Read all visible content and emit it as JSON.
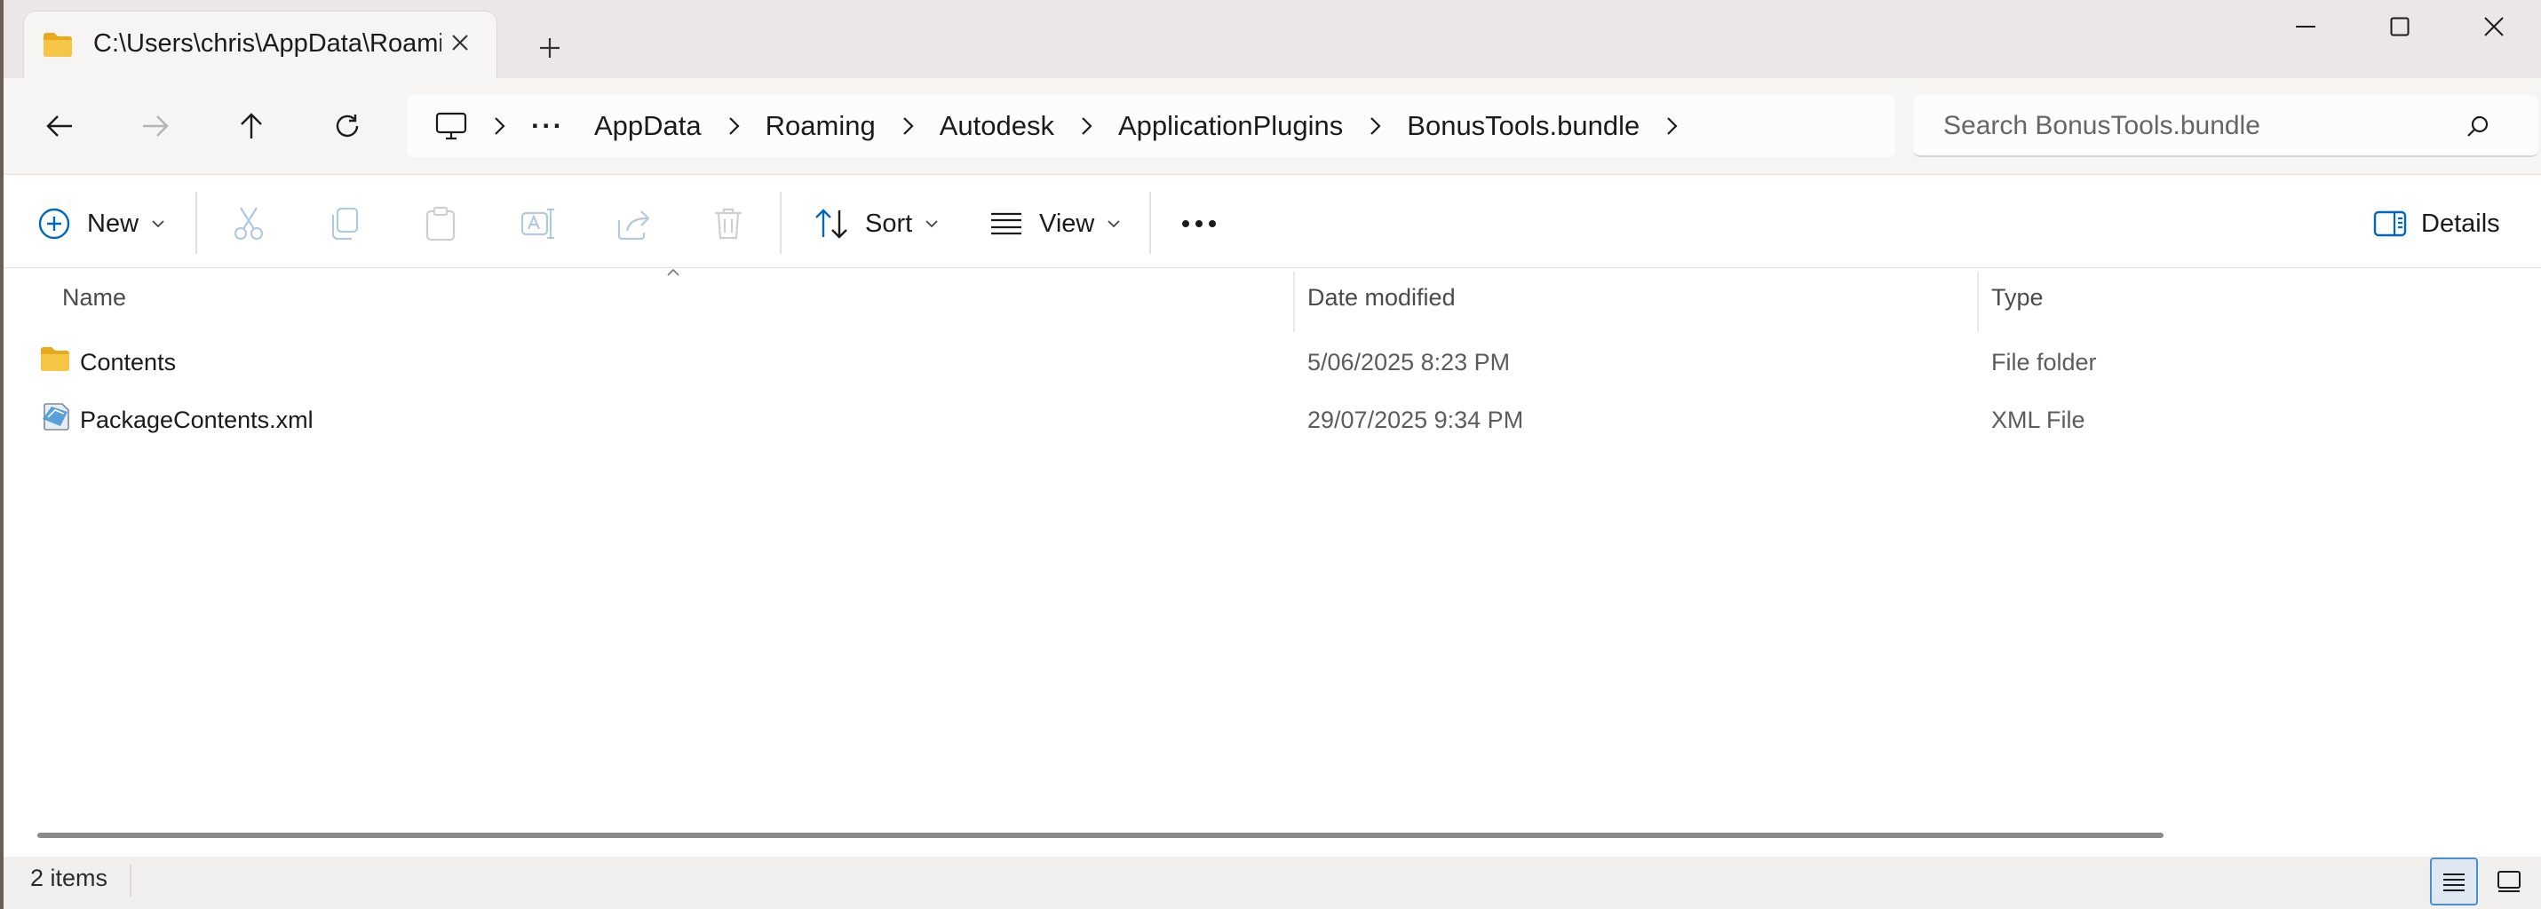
{
  "window": {
    "tab_title": "C:\\Users\\chris\\AppData\\Roaming\\Autodesk\\ApplicationPlugins\\BonusTools.bundle",
    "new_tab_label": "+"
  },
  "nav": {
    "breadcrumb": [
      "AppData",
      "Roaming",
      "Autodesk",
      "ApplicationPlugins",
      "BonusTools.bundle"
    ],
    "overflow_label": "···",
    "search_placeholder": "Search BonusTools.bundle"
  },
  "commands": {
    "new_label": "New",
    "sort_label": "Sort",
    "view_label": "View",
    "details_label": "Details"
  },
  "columns": {
    "name": "Name",
    "date": "Date modified",
    "type": "Type"
  },
  "files": [
    {
      "name": "Contents",
      "date": "5/06/2025 8:23 PM",
      "type": "File folder",
      "icon": "folder-icon"
    },
    {
      "name": "PackageContents.xml",
      "date": "29/07/2025 9:34 PM",
      "type": "XML File",
      "icon": "xml-file-icon"
    }
  ],
  "status": {
    "item_count": "2 items"
  },
  "colors": {
    "accent": "#0067c0",
    "folder": "#f6c546"
  }
}
